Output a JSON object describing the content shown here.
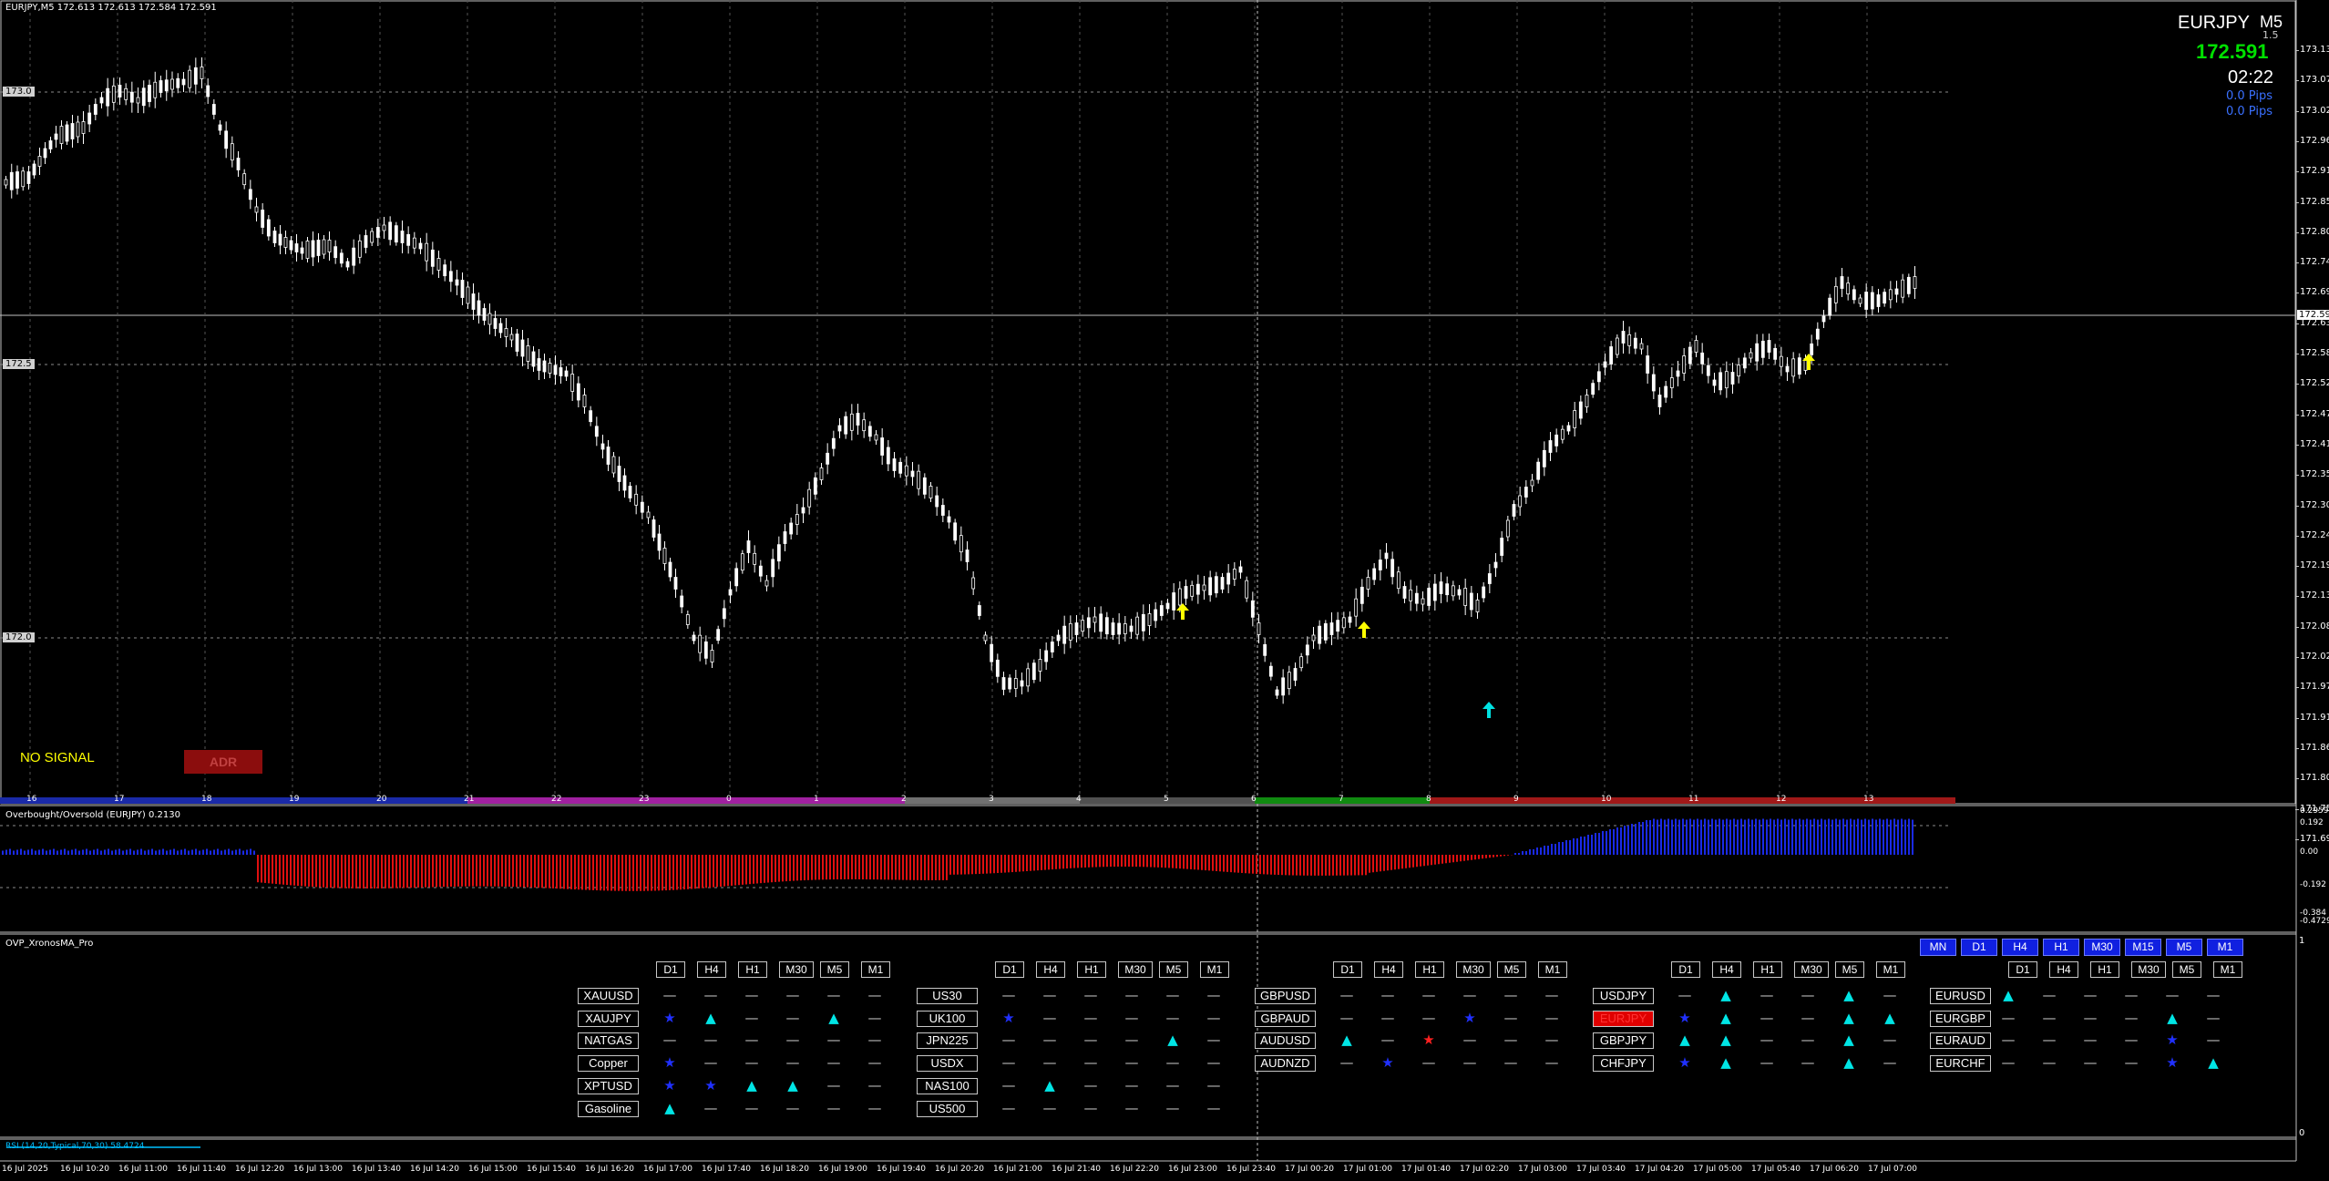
{
  "header": {
    "chart_caption": "EURJPY,M5  172.613 172.613 172.584 172.591",
    "symbol": "EURJPY",
    "timeframe": "M5",
    "spread": "1.5",
    "price": "172.591",
    "timer": "02:22",
    "pips_1": "0.0 Pips",
    "pips_2": "0.0 Pips"
  },
  "main_chart": {
    "no_signal": "NO SIGNAL",
    "adr_button": "ADR",
    "left_price_labels": [
      "173.0",
      "172.5",
      "172.0"
    ],
    "current_price_tag": "172.591",
    "y_ticks": [
      "173.132",
      "173.077",
      "173.022",
      "172.967",
      "172.912",
      "172.857",
      "172.802",
      "172.747",
      "172.692",
      "172.637",
      "172.582",
      "172.527",
      "172.472",
      "172.412",
      "172.357",
      "172.302",
      "172.247",
      "172.192",
      "172.137",
      "172.082",
      "172.027",
      "171.972",
      "171.917",
      "171.862",
      "171.807",
      "171.752",
      "171.697"
    ],
    "hour_labels": [
      "16",
      "17",
      "18",
      "19",
      "20",
      "21",
      "22",
      "23",
      "0",
      "1",
      "2",
      "3",
      "4",
      "5",
      "6",
      "7",
      "8",
      "9",
      "10",
      "11",
      "12",
      "13"
    ]
  },
  "oscillator": {
    "title": "Overbought/Oversold (EURJPY) 0.2130",
    "y_ticks": [
      "0.2959",
      "0.192",
      "0.00",
      "-0.192",
      "-0.384",
      "-0.4729"
    ]
  },
  "panel": {
    "title": "OVP_XronosMA_Pro",
    "tf_headers": [
      "D1",
      "H4",
      "H1",
      "M30",
      "M5",
      "M1"
    ],
    "top_buttons": [
      "MN",
      "D1",
      "H4",
      "H1",
      "M30",
      "M15",
      "M5",
      "M1"
    ],
    "groups": [
      {
        "symbols": [
          "XAUUSD",
          "XAUJPY",
          "NATGAS",
          "Copper",
          "XPTUSD",
          "Gasoline"
        ]
      },
      {
        "symbols": [
          "US30",
          "UK100",
          "JPN225",
          "USDX",
          "NAS100",
          "US500"
        ]
      },
      {
        "symbols": [
          "GBPUSD",
          "GBPAUD",
          "AUDUSD",
          "AUDNZD"
        ]
      },
      {
        "symbols": [
          "USDJPY",
          "EURJPY",
          "GBPJPY",
          "CHFJPY"
        ]
      },
      {
        "symbols": [
          "EURUSD",
          "EURGBP",
          "EURAUD",
          "EURCHF"
        ]
      }
    ]
  },
  "rsi": {
    "label": "RSI (14,20,Typical,70,30) 58.4724"
  },
  "time_axis": [
    "16 Jul 2025",
    "16 Jul 10:20",
    "16 Jul 11:00",
    "16 Jul 11:40",
    "16 Jul 12:20",
    "16 Jul 13:00",
    "16 Jul 13:40",
    "16 Jul 14:20",
    "16 Jul 15:00",
    "16 Jul 15:40",
    "16 Jul 16:20",
    "16 Jul 17:00",
    "16 Jul 17:40",
    "16 Jul 18:20",
    "16 Jul 19:00",
    "16 Jul 19:40",
    "16 Jul 20:20",
    "16 Jul 21:00",
    "16 Jul 21:40",
    "16 Jul 22:20",
    "16 Jul 23:00",
    "16 Jul 23:40",
    "17 Jul 00:20",
    "17 Jul 01:00",
    "17 Jul 01:40",
    "17 Jul 02:20",
    "17 Jul 03:00",
    "17 Jul 03:40",
    "17 Jul 04:20",
    "17 Jul 05:00",
    "17 Jul 05:40",
    "17 Jul 06:20",
    "17 Jul 07:00"
  ],
  "colors": {
    "price_green": "#00e000",
    "pips_blue": "#3a70ff",
    "osc_negative": "#e01010",
    "osc_positive": "#1a2ae6",
    "signal_yellow": "#ffff00",
    "signal_cyan": "#00e0e0",
    "adr_bg": "#8b0d0d",
    "active_symbol_bg": "#e00000",
    "tf_button_blue": "#1020e0"
  }
}
